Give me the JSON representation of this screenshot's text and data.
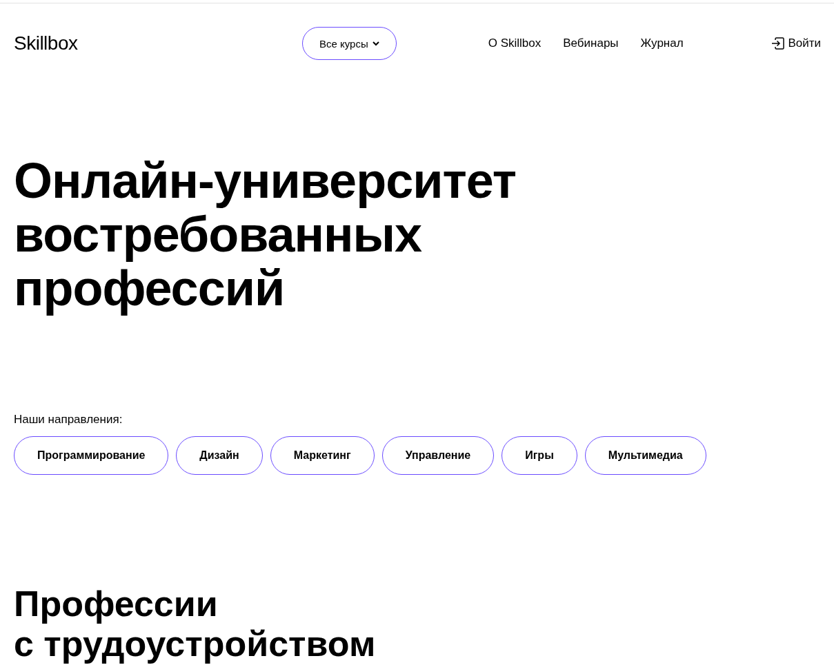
{
  "header": {
    "logo": "Skillbox",
    "courses_button": "Все курсы",
    "nav": [
      "О Skillbox",
      "Вебинары",
      "Журнал"
    ],
    "login": "Войти"
  },
  "hero": {
    "title_lines": [
      "Онлайн-университет",
      "востребованных",
      "профессий"
    ]
  },
  "directions": {
    "label": "Наши направления:",
    "items": [
      "Программирование",
      "Дизайн",
      "Маркетинг",
      "Управление",
      "Игры",
      "Мультимедиа"
    ]
  },
  "section": {
    "title_lines": [
      "Профессии",
      "с трудоустройством"
    ]
  }
}
